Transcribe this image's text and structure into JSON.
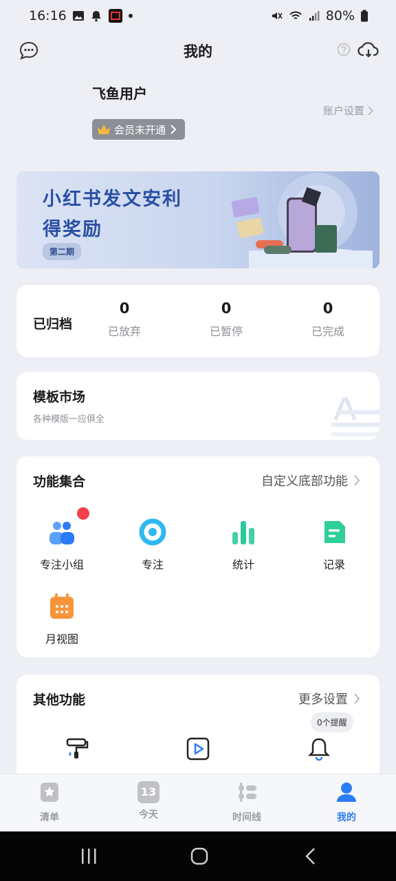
{
  "status": {
    "time": "16:16",
    "battery": "80%"
  },
  "header": {
    "title": "我的"
  },
  "profile": {
    "username": "飞鱼用户",
    "vip_label": "会员未开通",
    "account_settings": "账户设置"
  },
  "banner": {
    "line1": "小红书发文安利",
    "line2": "得奖励",
    "issue": "第二期"
  },
  "archive": {
    "label": "已归档",
    "stats": [
      {
        "value": "0",
        "label": "已放弃"
      },
      {
        "value": "0",
        "label": "已暂停"
      },
      {
        "value": "0",
        "label": "已完成"
      }
    ]
  },
  "template_market": {
    "title": "模板市场",
    "subtitle": "各种模版一应俱全"
  },
  "functions": {
    "title": "功能集合",
    "link": "自定义底部功能",
    "items": [
      {
        "label": "专注小组",
        "icon": "group-icon"
      },
      {
        "label": "专注",
        "icon": "focus-icon"
      },
      {
        "label": "统计",
        "icon": "stats-icon"
      },
      {
        "label": "记录",
        "icon": "record-icon"
      },
      {
        "label": "月视图",
        "icon": "calendar-icon"
      }
    ]
  },
  "other": {
    "title": "其他功能",
    "link": "更多设置",
    "reminder_badge": "0个提醒",
    "icons": [
      "paint-roller-icon",
      "play-icon",
      "bell-icon"
    ]
  },
  "tabbar": {
    "tabs": [
      {
        "label": "清单",
        "icon": "star-doc-icon"
      },
      {
        "label": "今天",
        "icon": "calendar-day-icon",
        "day": "13"
      },
      {
        "label": "时间线",
        "icon": "timeline-icon"
      },
      {
        "label": "我的",
        "icon": "person-icon"
      }
    ],
    "active_index": 3,
    "accent_color": "#2c7cf6"
  }
}
